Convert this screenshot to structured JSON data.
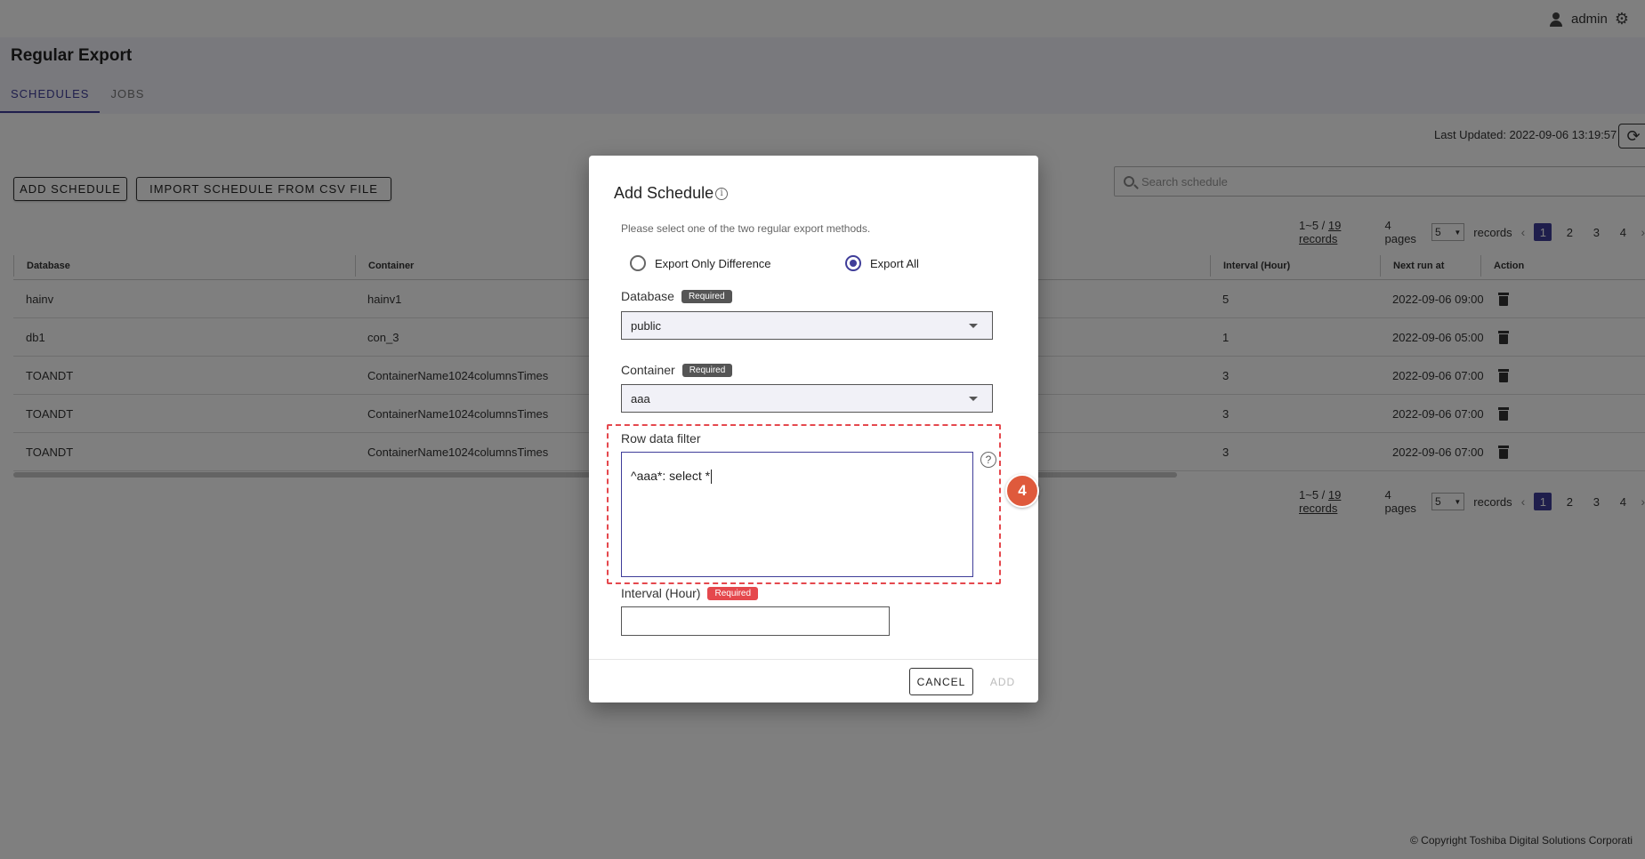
{
  "topbar": {
    "username": "admin"
  },
  "header": {
    "title": "Regular Export",
    "tabs": [
      "SCHEDULES",
      "JOBS"
    ]
  },
  "toolbar": {
    "last_updated": "Last Updated: 2022-09-06 13:19:57",
    "add_schedule": "ADD SCHEDULE",
    "import_csv": "IMPORT SCHEDULE FROM CSV FILE",
    "search_placeholder": "Search schedule"
  },
  "pagination": {
    "range": "1~5 /",
    "records_link": "19 records",
    "pages": "4 pages",
    "per_page": "5",
    "records_suffix": "records",
    "page_numbers": [
      "1",
      "2",
      "3",
      "4"
    ],
    "current_page": "1"
  },
  "table": {
    "headers": [
      "Database",
      "Container",
      "Interval (Hour)",
      "Next run at",
      "Action"
    ],
    "rows": [
      {
        "database": "hainv",
        "container": "hainv1",
        "interval": "5",
        "next_run": "2022-09-06 09:00"
      },
      {
        "database": "db1",
        "container": "con_3",
        "interval": "1",
        "next_run": "2022-09-06 05:00"
      },
      {
        "database": "TOANDT",
        "container": "ContainerName1024columnsTimes",
        "interval": "3",
        "next_run": "2022-09-06 07:00"
      },
      {
        "database": "TOANDT",
        "container": "ContainerName1024columnsTimes",
        "interval": "3",
        "next_run": "2022-09-06 07:00"
      },
      {
        "database": "TOANDT",
        "container": "ContainerName1024columnsTimes",
        "interval": "3",
        "next_run": "2022-09-06 07:00"
      }
    ]
  },
  "dialog": {
    "title": "Add Schedule",
    "description": "Please select one of the two regular export methods.",
    "option_difference": "Export Only Difference",
    "option_all": "Export All",
    "database_label": "Database",
    "database_value": "public",
    "container_label": "Container",
    "container_value": "aaa",
    "required_badge": "Required",
    "filter_label": "Row data filter",
    "filter_value": "^aaa*: select *",
    "interval_label": "Interval (Hour)",
    "interval_value": "",
    "cancel_label": "CANCEL",
    "add_label": "ADD",
    "step_number": "4"
  },
  "footer": {
    "copyright": "© Copyright Toshiba Digital Solutions Corporati"
  },
  "colors": {
    "accent": "#3f3d99",
    "required_red": "#e5484d",
    "step_badge": "#df5a3c",
    "overlay": "rgba(0,0,0,0.5)"
  }
}
